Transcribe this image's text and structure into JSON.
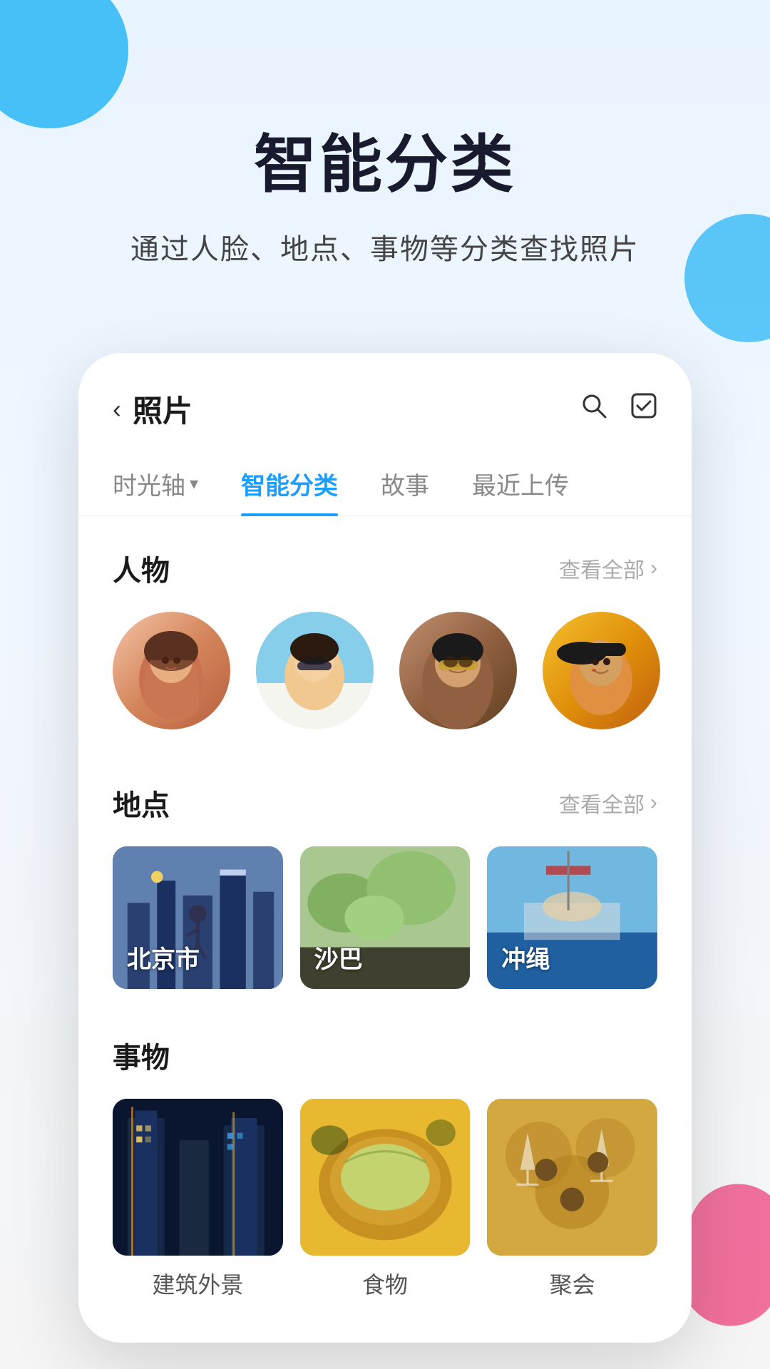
{
  "hero": {
    "title": "智能分类",
    "subtitle": "通过人脸、地点、事物等分类查找照片"
  },
  "app": {
    "header": {
      "back_icon": "‹",
      "title": "照片",
      "search_icon": "⌕",
      "select_icon": "☑"
    },
    "tabs": [
      {
        "id": "timeline",
        "label": "时光轴",
        "has_dropdown": true,
        "active": false
      },
      {
        "id": "smart",
        "label": "智能分类",
        "has_dropdown": false,
        "active": true
      },
      {
        "id": "story",
        "label": "故事",
        "has_dropdown": false,
        "active": false
      },
      {
        "id": "recent",
        "label": "最近上传",
        "has_dropdown": false,
        "active": false
      }
    ],
    "sections": {
      "people": {
        "title": "人物",
        "view_all": "查看全部",
        "avatars": [
          {
            "id": "person-1",
            "bg": "avatar-1"
          },
          {
            "id": "person-2",
            "bg": "avatar-2"
          },
          {
            "id": "person-3",
            "bg": "avatar-3"
          },
          {
            "id": "person-4",
            "bg": "avatar-4"
          }
        ]
      },
      "locations": {
        "title": "地点",
        "view_all": "查看全部",
        "items": [
          {
            "id": "beijing",
            "label": "北京市",
            "bg": "location-bg-1"
          },
          {
            "id": "saba",
            "label": "沙巴",
            "bg": "location-bg-2"
          },
          {
            "id": "okinawa",
            "label": "冲绳",
            "bg": "location-bg-3"
          }
        ]
      },
      "things": {
        "title": "事物",
        "items": [
          {
            "id": "architecture",
            "label": "建筑外景",
            "bg": "thing-bg-1"
          },
          {
            "id": "food",
            "label": "食物",
            "bg": "thing-bg-2"
          },
          {
            "id": "party",
            "label": "聚会",
            "bg": "thing-bg-3"
          }
        ]
      }
    }
  },
  "colors": {
    "accent": "#1a9eff",
    "title": "#1a1a2e",
    "subtitle": "#444444"
  }
}
